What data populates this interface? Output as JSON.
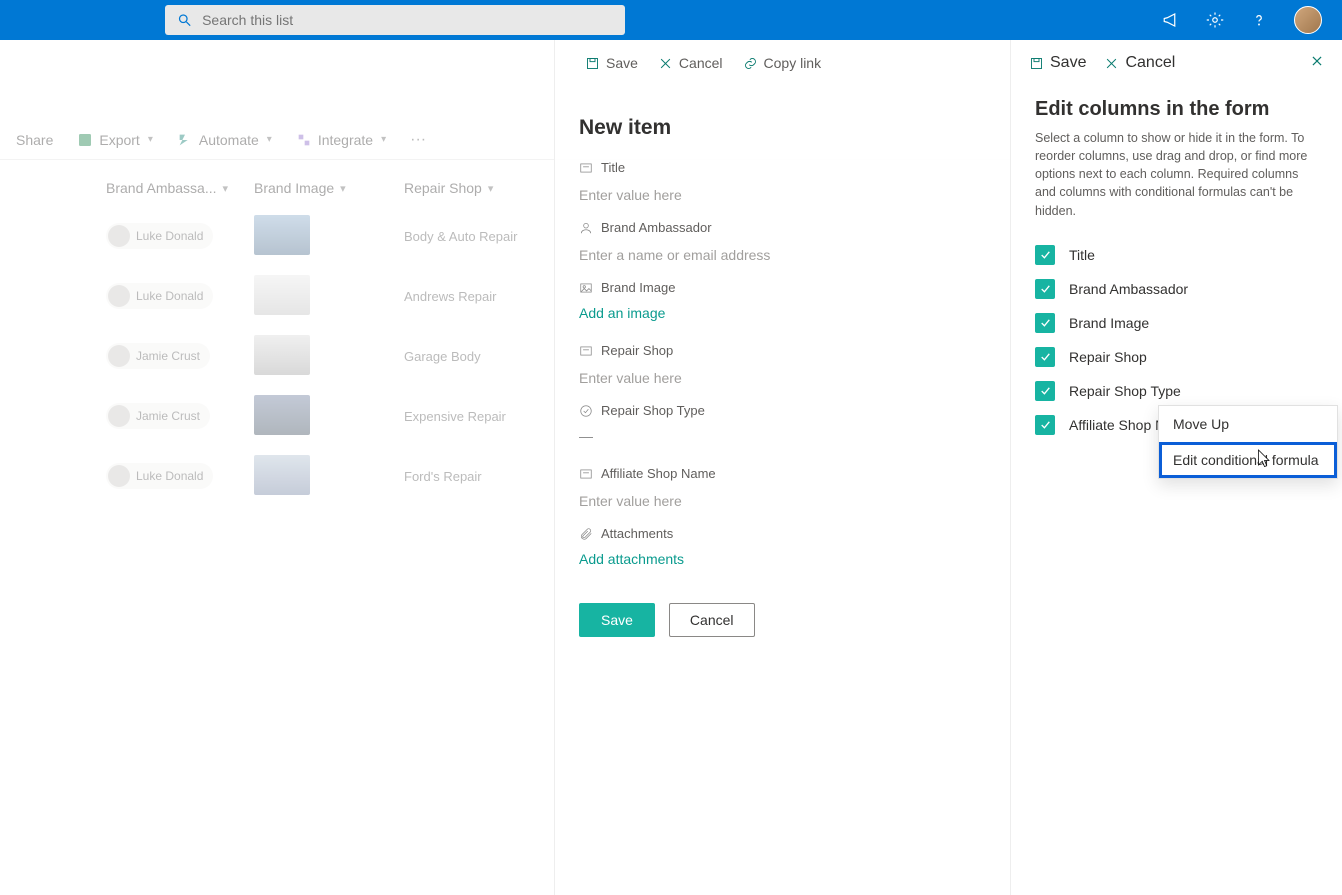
{
  "topbar": {
    "search_placeholder": "Search this list"
  },
  "cmdbar": {
    "share": "Share",
    "export": "Export",
    "automate": "Automate",
    "integrate": "Integrate"
  },
  "list": {
    "columns": [
      "Brand Ambassa...",
      "Brand Image",
      "Repair Shop"
    ],
    "rows": [
      {
        "ambassador": "Luke Donald",
        "shop": "Body & Auto Repair"
      },
      {
        "ambassador": "Luke Donald",
        "shop": "Andrews Repair"
      },
      {
        "ambassador": "Jamie Crust",
        "shop": "Garage Body"
      },
      {
        "ambassador": "Jamie Crust",
        "shop": "Expensive Repair"
      },
      {
        "ambassador": "Luke Donald",
        "shop": "Ford's Repair"
      }
    ]
  },
  "newItem": {
    "cmd": {
      "save": "Save",
      "cancel": "Cancel",
      "copy": "Copy link"
    },
    "title": "New item",
    "fields": {
      "title": {
        "label": "Title",
        "placeholder": "Enter value here"
      },
      "ambassador": {
        "label": "Brand Ambassador",
        "placeholder": "Enter a name or email address"
      },
      "image": {
        "label": "Brand Image",
        "link": "Add an image"
      },
      "repair": {
        "label": "Repair Shop",
        "placeholder": "Enter value here"
      },
      "type": {
        "label": "Repair Shop Type",
        "value": "—"
      },
      "affiliate": {
        "label": "Affiliate Shop Name",
        "placeholder": "Enter value here"
      },
      "attach": {
        "label": "Attachments",
        "link": "Add attachments"
      }
    },
    "save": "Save",
    "cancel": "Cancel"
  },
  "editCols": {
    "cmd": {
      "save": "Save",
      "cancel": "Cancel"
    },
    "title": "Edit columns in the form",
    "desc": "Select a column to show or hide it in the form. To reorder columns, use drag and drop, or find more options next to each column. Required columns and columns with conditional formulas can't be hidden.",
    "items": [
      "Title",
      "Brand Ambassador",
      "Brand Image",
      "Repair Shop",
      "Repair Shop Type",
      "Affiliate Shop Name"
    ]
  },
  "ctx": {
    "moveUp": "Move Up",
    "editFormula": "Edit conditional formula"
  }
}
